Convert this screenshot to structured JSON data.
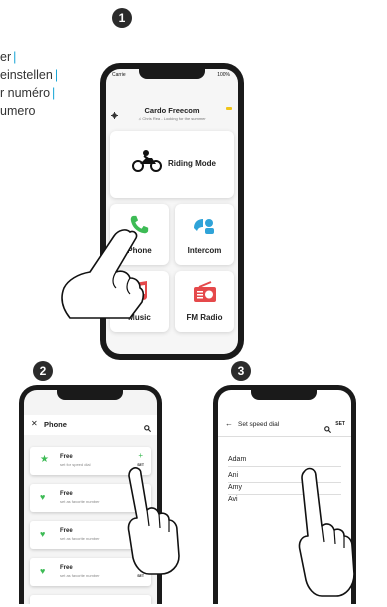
{
  "side_text": {
    "line1": "er",
    "line2": "einstellen",
    "line3": "r numéro",
    "line4": "umero"
  },
  "steps": {
    "s1": "1",
    "s2": "2",
    "s3": "3"
  },
  "phone1": {
    "status": {
      "carrier": "Carrie",
      "battery": "100%"
    },
    "header": {
      "title": "Cardo Freecom",
      "subtitle": "Chris Rea - Looking for the summer"
    },
    "tiles": {
      "riding": "Riding Mode",
      "phone": "Phone",
      "intercom": "Intercom",
      "music": "Music",
      "fm": "FM Radio"
    }
  },
  "phone2": {
    "title": "Phone",
    "items": [
      {
        "title": "Free",
        "sub": "set for speed dial",
        "action": "SET"
      },
      {
        "title": "Free",
        "sub": "set as favorite number",
        "action": "SET"
      },
      {
        "title": "Free",
        "sub": "set as favorite number",
        "action": ""
      },
      {
        "title": "Free",
        "sub": "set as favorite number",
        "action": "SET"
      }
    ]
  },
  "phone3": {
    "title": "Set speed dial",
    "action": "SET",
    "contacts": [
      "Adam",
      "Ani",
      "Amy",
      "Avi"
    ]
  },
  "colors": {
    "accent": "#1aa6d6",
    "green": "#3dbb55",
    "blue": "#2fa3d8",
    "red": "#e5494b",
    "yellow": "#f0c419"
  }
}
